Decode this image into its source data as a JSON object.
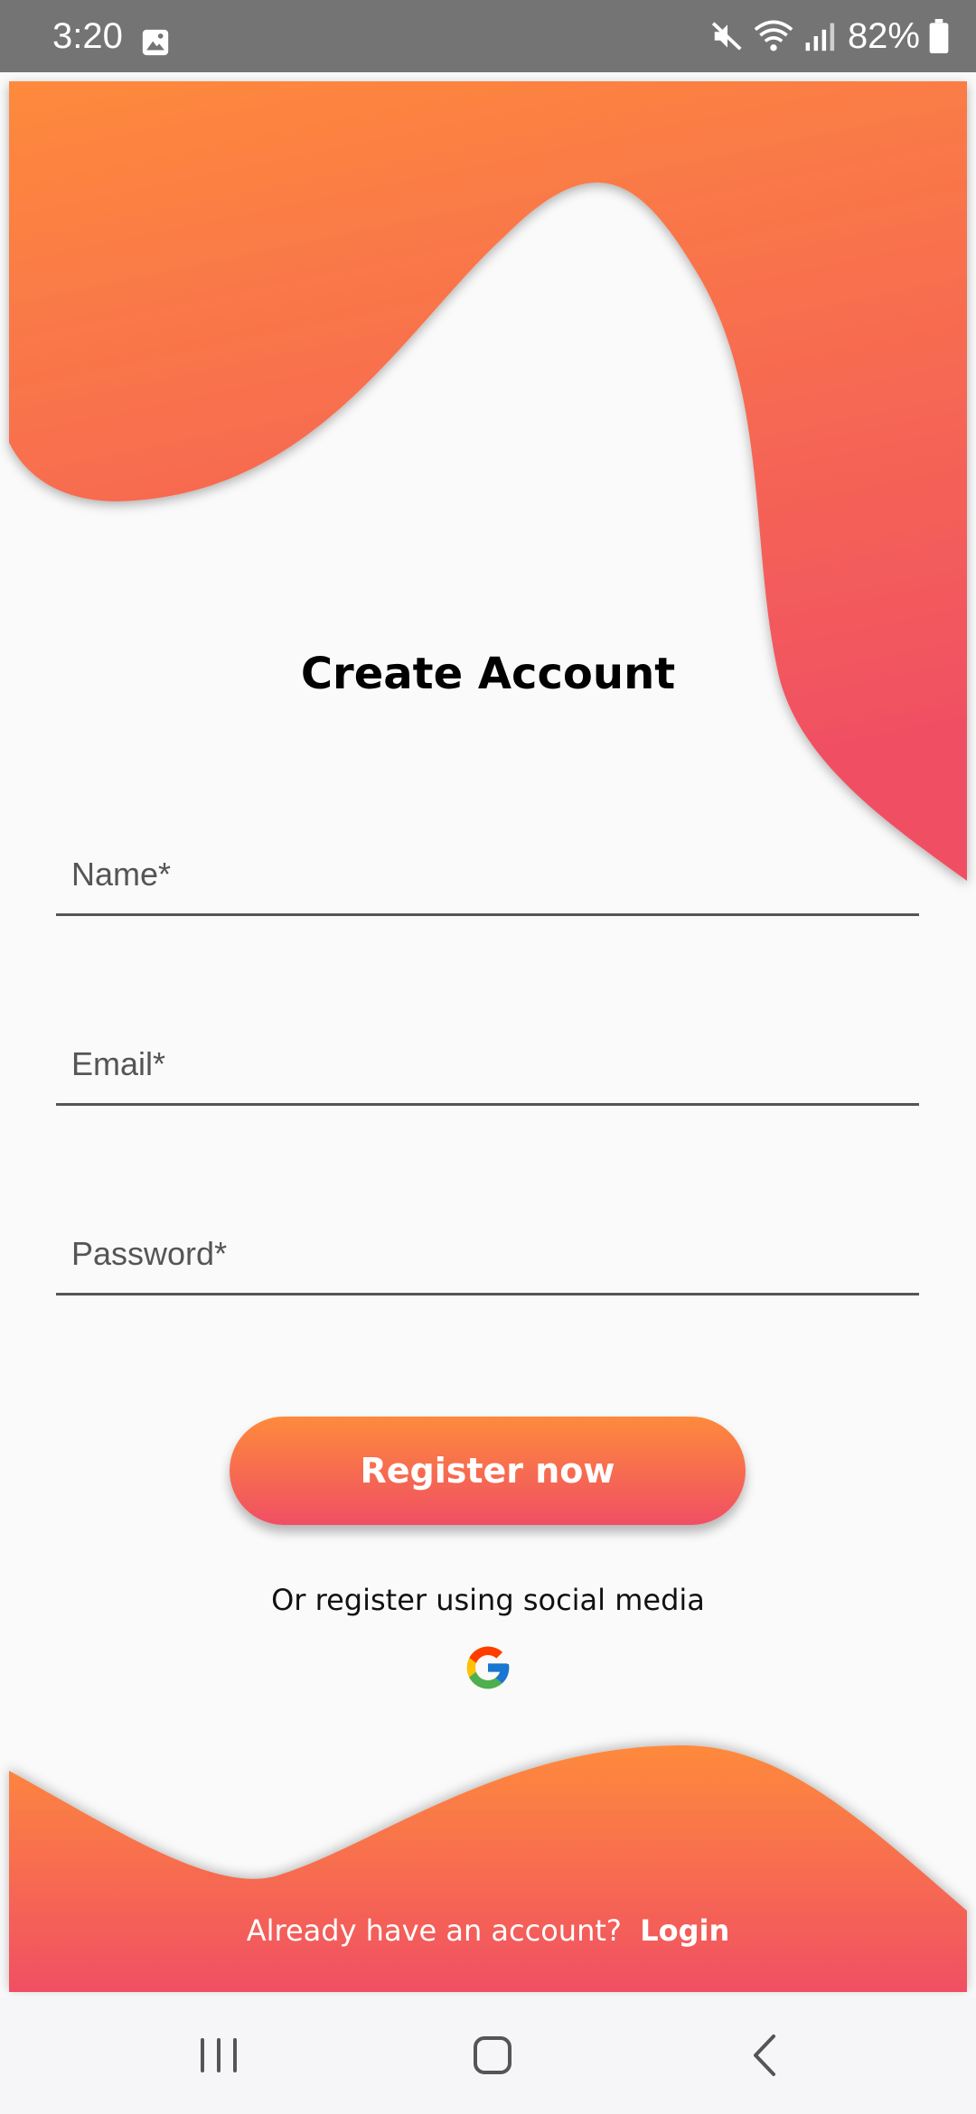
{
  "status_bar": {
    "time": "3:20",
    "battery": "82%",
    "icons": [
      "gallery-icon",
      "mute-icon",
      "wifi-icon",
      "signal-icon",
      "battery-icon"
    ]
  },
  "page": {
    "title": "Create Account",
    "fields": {
      "name_placeholder": "Name*",
      "email_placeholder": "Email*",
      "password_placeholder": "Password*"
    },
    "register_label": "Register now",
    "social_text": "Or register using social media",
    "social_icons": [
      "google-icon"
    ],
    "login_prompt": "Already have an account?",
    "login_link": "Login"
  },
  "nav_bar": {
    "icons": [
      "recent-apps-icon",
      "home-icon",
      "back-icon"
    ]
  },
  "colors": {
    "gradient_top": "#fe8a3c",
    "gradient_bottom": "#f04f63",
    "background": "#fafafa",
    "status_bar": "#747474"
  }
}
